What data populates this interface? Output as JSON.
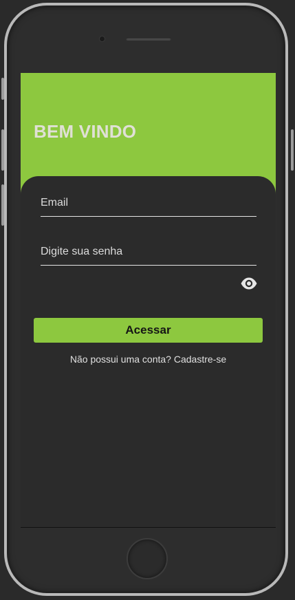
{
  "header": {
    "title": "BEM VINDO"
  },
  "form": {
    "email_placeholder": "Email",
    "password_placeholder": "Digite sua senha",
    "password_toggle_icon": "eye-icon",
    "submit_label": "Acessar"
  },
  "footer": {
    "question": "Não possui uma conta?",
    "link": "Cadastre-se"
  },
  "colors": {
    "accent": "#8dc83f",
    "panel": "#2b2b2b",
    "title_text": "#e0e0d6"
  }
}
